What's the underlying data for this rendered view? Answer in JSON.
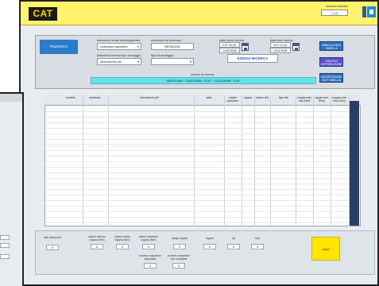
{
  "header": {
    "logo_text": "CAT",
    "version_label": "versione software",
    "version_value": "1.13"
  },
  "top_panel": {
    "brand_text": "PowerDCS",
    "mode_label": "selezione modo interrogazione",
    "mode_value": "matricola macchina",
    "matricola_label": "matricola da ricercare",
    "matricola_value": "NESSUNA",
    "data_inizio_label": "data inizio ricerca",
    "data_inizio_value_1": "4.57.15 (h)",
    "data_inizio_value_2": "14/02/2008",
    "data_fine_label": "data fine ricerca",
    "data_fine_value_1": "5.57.15 (h)",
    "data_fine_value_2": "14/11/2008",
    "search_type_label": "selezione ricerca tipo ormeggio",
    "search_type_value": "descrizione job",
    "tipo_label": "tipo di ormeggio",
    "tipo_value": "",
    "search_button": "ESEGUI RICERCA",
    "filter_label": "criterio di ricerca",
    "filter_value": "NESSUNA ÷ 14/02/2008 ÷ 5.57 ÷ 14/11/2008 ÷ 5.57",
    "side_buttons": [
      "ANNULLA DATI TABELLA",
      "GRAFICO DISTRIBUZIONE",
      "ESPORTAZIONE DATI TABELLA"
    ]
  },
  "table": {
    "columns": [
      "modello",
      "matricola",
      "descrizione job",
      "data",
      "codice operatore",
      "coppia",
      "codice vite",
      "tipo vite",
      "coppia max min (Nm)",
      "coppia serr. (Nm)",
      "coppia max nom (Nm)"
    ]
  },
  "stats": {
    "labels": [
      "valore minimo coppia (Nm)",
      "valore medio coppia (Nm)",
      "valore massimo coppia (Nm)",
      "range coppia",
      "sigma",
      "Cp",
      "Cpk"
    ],
    "values": [
      "0",
      "0",
      "0",
      "0",
      "0",
      "0",
      "0"
    ],
    "count_label": "dati campione",
    "count_value": "0",
    "bottom_labels": [
      "numero macchine esportate",
      "numero macchine non complete"
    ],
    "bottom_values": [
      "0",
      "0"
    ],
    "exit_button": "esci"
  }
}
